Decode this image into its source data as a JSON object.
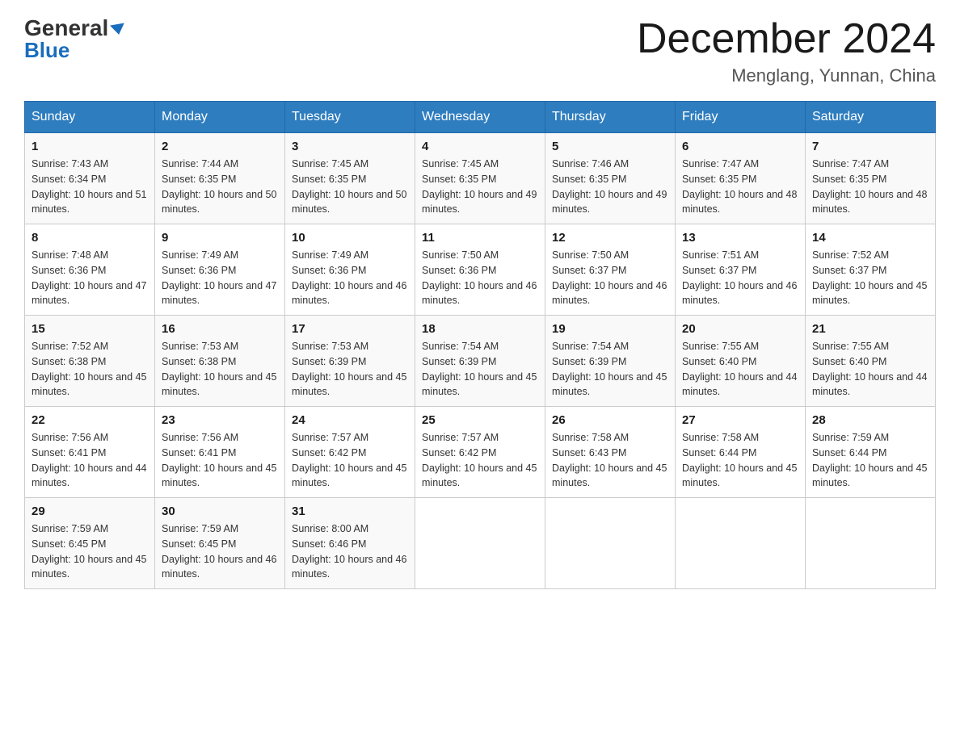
{
  "logo": {
    "general": "General",
    "arrow": "▶",
    "blue": "Blue"
  },
  "header": {
    "month_title": "December 2024",
    "location": "Menglang, Yunnan, China"
  },
  "days_of_week": [
    "Sunday",
    "Monday",
    "Tuesday",
    "Wednesday",
    "Thursday",
    "Friday",
    "Saturday"
  ],
  "weeks": [
    [
      {
        "day": "1",
        "sunrise": "7:43 AM",
        "sunset": "6:34 PM",
        "daylight": "10 hours and 51 minutes."
      },
      {
        "day": "2",
        "sunrise": "7:44 AM",
        "sunset": "6:35 PM",
        "daylight": "10 hours and 50 minutes."
      },
      {
        "day": "3",
        "sunrise": "7:45 AM",
        "sunset": "6:35 PM",
        "daylight": "10 hours and 50 minutes."
      },
      {
        "day": "4",
        "sunrise": "7:45 AM",
        "sunset": "6:35 PM",
        "daylight": "10 hours and 49 minutes."
      },
      {
        "day": "5",
        "sunrise": "7:46 AM",
        "sunset": "6:35 PM",
        "daylight": "10 hours and 49 minutes."
      },
      {
        "day": "6",
        "sunrise": "7:47 AM",
        "sunset": "6:35 PM",
        "daylight": "10 hours and 48 minutes."
      },
      {
        "day": "7",
        "sunrise": "7:47 AM",
        "sunset": "6:35 PM",
        "daylight": "10 hours and 48 minutes."
      }
    ],
    [
      {
        "day": "8",
        "sunrise": "7:48 AM",
        "sunset": "6:36 PM",
        "daylight": "10 hours and 47 minutes."
      },
      {
        "day": "9",
        "sunrise": "7:49 AM",
        "sunset": "6:36 PM",
        "daylight": "10 hours and 47 minutes."
      },
      {
        "day": "10",
        "sunrise": "7:49 AM",
        "sunset": "6:36 PM",
        "daylight": "10 hours and 46 minutes."
      },
      {
        "day": "11",
        "sunrise": "7:50 AM",
        "sunset": "6:36 PM",
        "daylight": "10 hours and 46 minutes."
      },
      {
        "day": "12",
        "sunrise": "7:50 AM",
        "sunset": "6:37 PM",
        "daylight": "10 hours and 46 minutes."
      },
      {
        "day": "13",
        "sunrise": "7:51 AM",
        "sunset": "6:37 PM",
        "daylight": "10 hours and 46 minutes."
      },
      {
        "day": "14",
        "sunrise": "7:52 AM",
        "sunset": "6:37 PM",
        "daylight": "10 hours and 45 minutes."
      }
    ],
    [
      {
        "day": "15",
        "sunrise": "7:52 AM",
        "sunset": "6:38 PM",
        "daylight": "10 hours and 45 minutes."
      },
      {
        "day": "16",
        "sunrise": "7:53 AM",
        "sunset": "6:38 PM",
        "daylight": "10 hours and 45 minutes."
      },
      {
        "day": "17",
        "sunrise": "7:53 AM",
        "sunset": "6:39 PM",
        "daylight": "10 hours and 45 minutes."
      },
      {
        "day": "18",
        "sunrise": "7:54 AM",
        "sunset": "6:39 PM",
        "daylight": "10 hours and 45 minutes."
      },
      {
        "day": "19",
        "sunrise": "7:54 AM",
        "sunset": "6:39 PM",
        "daylight": "10 hours and 45 minutes."
      },
      {
        "day": "20",
        "sunrise": "7:55 AM",
        "sunset": "6:40 PM",
        "daylight": "10 hours and 44 minutes."
      },
      {
        "day": "21",
        "sunrise": "7:55 AM",
        "sunset": "6:40 PM",
        "daylight": "10 hours and 44 minutes."
      }
    ],
    [
      {
        "day": "22",
        "sunrise": "7:56 AM",
        "sunset": "6:41 PM",
        "daylight": "10 hours and 44 minutes."
      },
      {
        "day": "23",
        "sunrise": "7:56 AM",
        "sunset": "6:41 PM",
        "daylight": "10 hours and 45 minutes."
      },
      {
        "day": "24",
        "sunrise": "7:57 AM",
        "sunset": "6:42 PM",
        "daylight": "10 hours and 45 minutes."
      },
      {
        "day": "25",
        "sunrise": "7:57 AM",
        "sunset": "6:42 PM",
        "daylight": "10 hours and 45 minutes."
      },
      {
        "day": "26",
        "sunrise": "7:58 AM",
        "sunset": "6:43 PM",
        "daylight": "10 hours and 45 minutes."
      },
      {
        "day": "27",
        "sunrise": "7:58 AM",
        "sunset": "6:44 PM",
        "daylight": "10 hours and 45 minutes."
      },
      {
        "day": "28",
        "sunrise": "7:59 AM",
        "sunset": "6:44 PM",
        "daylight": "10 hours and 45 minutes."
      }
    ],
    [
      {
        "day": "29",
        "sunrise": "7:59 AM",
        "sunset": "6:45 PM",
        "daylight": "10 hours and 45 minutes."
      },
      {
        "day": "30",
        "sunrise": "7:59 AM",
        "sunset": "6:45 PM",
        "daylight": "10 hours and 46 minutes."
      },
      {
        "day": "31",
        "sunrise": "8:00 AM",
        "sunset": "6:46 PM",
        "daylight": "10 hours and 46 minutes."
      },
      null,
      null,
      null,
      null
    ]
  ]
}
